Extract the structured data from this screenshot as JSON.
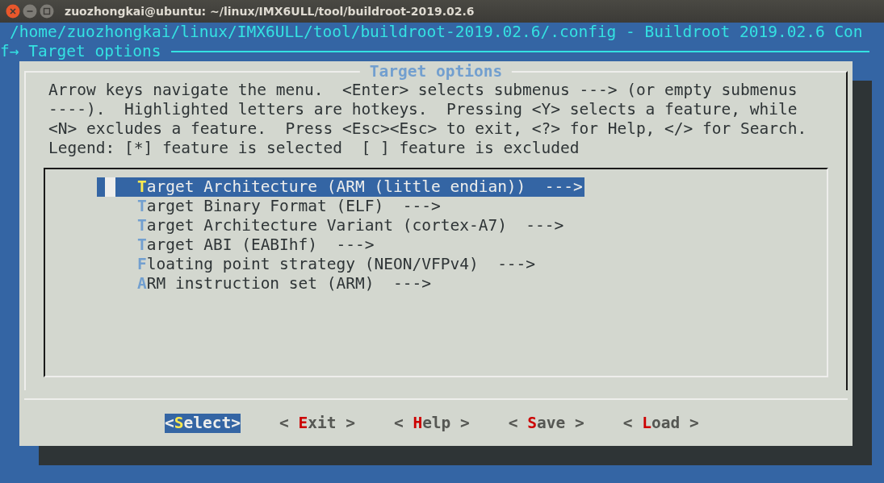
{
  "window": {
    "title": "zuozhongkai@ubuntu: ~/linux/IMX6ULL/tool/buildroot-2019.02.6"
  },
  "header": {
    "path": "/home/zuozhongkai/linux/IMX6ULL/tool/buildroot-2019.02.6/.config - Buildroot 2019.02.6 Con",
    "breadcrumb": "f→ Target options"
  },
  "dialog": {
    "title": "Target options",
    "help_lines": [
      "Arrow keys navigate the menu.  <Enter> selects submenus ---> (or empty submenus",
      "----).  Highlighted letters are hotkeys.  Pressing <Y> selects a feature, while",
      "<N> excludes a feature.  Press <Esc><Esc> to exit, <?> for Help, </> for Search."
    ],
    "legend": "Legend: [*] feature is selected  [ ] feature is excluded",
    "menu_items": [
      {
        "hotkey": "T",
        "rest": "arget Architecture (ARM (little endian))  --->",
        "selected": true
      },
      {
        "hotkey": "T",
        "rest": "arget Binary Format (ELF)  --->",
        "selected": false
      },
      {
        "hotkey": "T",
        "rest": "arget Architecture Variant (cortex-A7)  --->",
        "selected": false
      },
      {
        "hotkey": "T",
        "rest": "arget ABI (EABIhf)  --->",
        "selected": false
      },
      {
        "hotkey": "F",
        "rest": "loating point strategy (NEON/VFPv4)  --->",
        "selected": false
      },
      {
        "hotkey": "A",
        "rest": "RM instruction set (ARM)  --->",
        "selected": false
      }
    ],
    "buttons": [
      {
        "before": "<",
        "hotkey": "S",
        "after": "elect>",
        "selected": true
      },
      {
        "before": "< ",
        "hotkey": "E",
        "after": "xit >",
        "selected": false
      },
      {
        "before": "< ",
        "hotkey": "H",
        "after": "elp >",
        "selected": false
      },
      {
        "before": "< ",
        "hotkey": "S",
        "after": "ave >",
        "selected": false
      },
      {
        "before": "< ",
        "hotkey": "L",
        "after": "oad >",
        "selected": false
      }
    ]
  }
}
